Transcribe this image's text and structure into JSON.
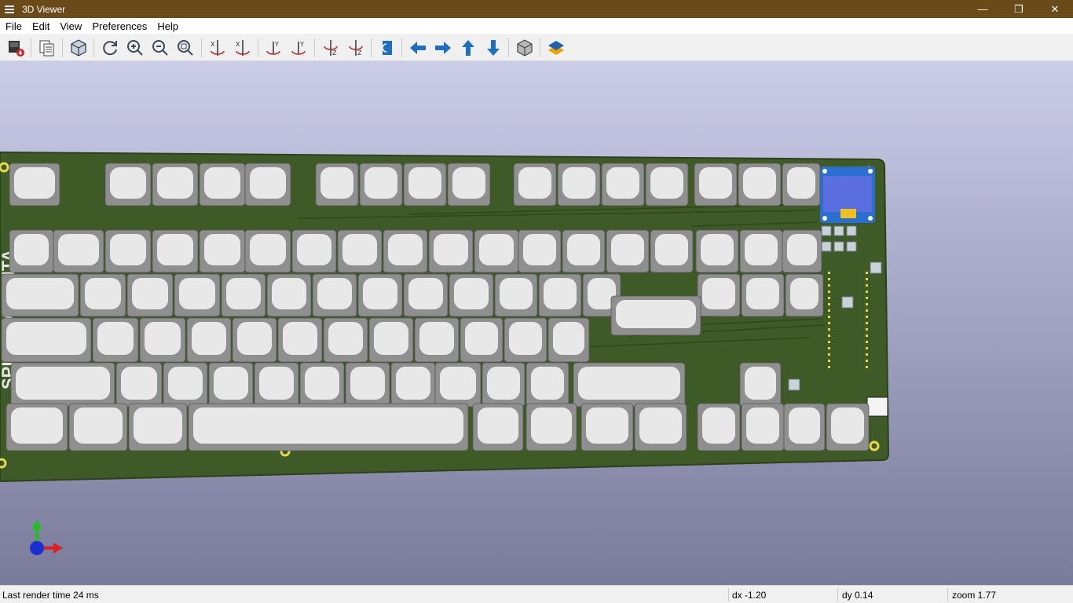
{
  "window": {
    "title": "3D Viewer",
    "minimize_glyph": "—",
    "maximize_glyph": "❐",
    "close_glyph": "✕"
  },
  "menu": [
    "File",
    "Edit",
    "View",
    "Preferences",
    "Help"
  ],
  "toolbar": [
    {
      "icon": "export-image-icon"
    },
    {
      "icon": "copy-icon"
    },
    {
      "icon": "raytracing-cube-icon"
    },
    {
      "icon": "reload-icon"
    },
    {
      "icon": "zoom-in-icon"
    },
    {
      "icon": "zoom-out-icon"
    },
    {
      "icon": "zoom-fit-icon"
    },
    {
      "icon": "rotate-x-cw-icon"
    },
    {
      "icon": "rotate-x-ccw-icon"
    },
    {
      "icon": "rotate-y-cw-icon"
    },
    {
      "icon": "rotate-y-ccw-icon"
    },
    {
      "icon": "rotate-z-cw-icon"
    },
    {
      "icon": "rotate-z-ccw-icon"
    },
    {
      "icon": "flip-board-icon"
    },
    {
      "icon": "move-left-icon"
    },
    {
      "icon": "move-right-icon"
    },
    {
      "icon": "move-up-icon"
    },
    {
      "icon": "move-down-icon"
    },
    {
      "icon": "orthographic-icon"
    },
    {
      "icon": "layers-icon"
    }
  ],
  "board": {
    "silkscreen_text": "SPIDER ANANTA",
    "pcb_color": "#3e5a26",
    "keycap_color": "#e8e8e8",
    "oled_color": "#5a6ee0"
  },
  "status": {
    "render_time": "Last render time 24 ms",
    "dx": "dx -1.20",
    "dy": "dy 0.14",
    "zoom": "zoom 1.77"
  }
}
